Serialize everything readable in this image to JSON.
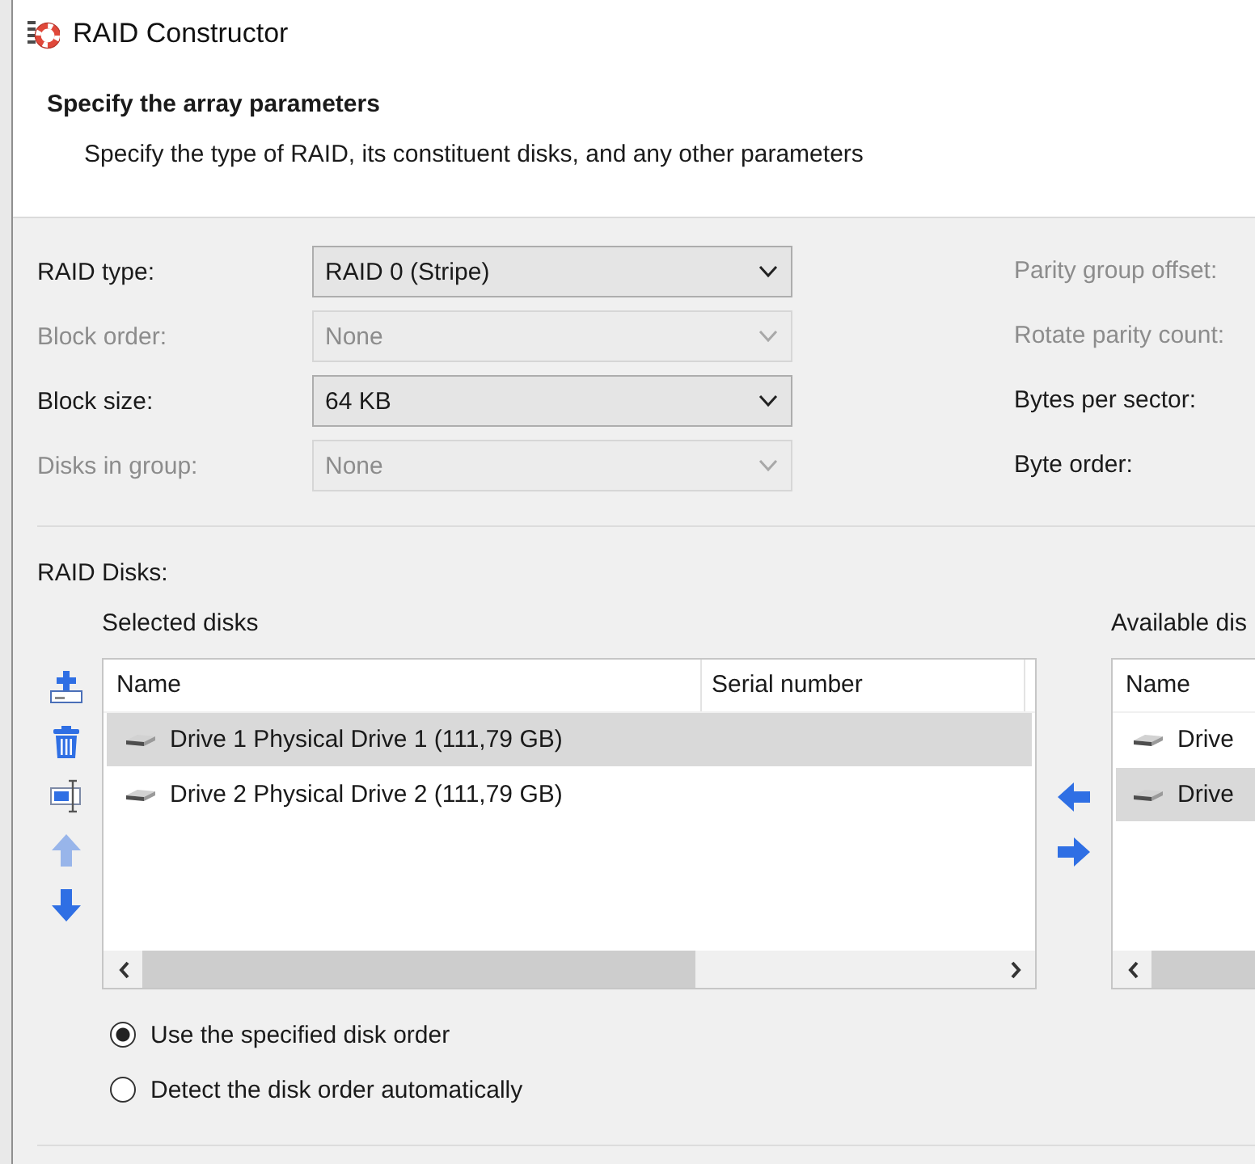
{
  "window": {
    "title": "RAID Constructor"
  },
  "header": {
    "title": "Specify the array parameters",
    "subtitle": "Specify the type of RAID, its constituent disks, and any other parameters"
  },
  "parameters": [
    {
      "label": "RAID type:",
      "value": "RAID 0 (Stripe)",
      "disabled": false
    },
    {
      "label": "Block order:",
      "value": "None",
      "disabled": true
    },
    {
      "label": "Block size:",
      "value": "64 KB",
      "disabled": false
    },
    {
      "label": "Disks in group:",
      "value": "None",
      "disabled": true
    }
  ],
  "side_parameters": [
    {
      "label": "Parity group offset:",
      "disabled": true
    },
    {
      "label": "Rotate parity count:",
      "disabled": true
    },
    {
      "label": "Bytes per sector:",
      "disabled": false
    },
    {
      "label": "Byte order:",
      "disabled": false
    }
  ],
  "disks": {
    "label": "RAID Disks:",
    "toolbar": [
      {
        "kind": "add",
        "disabled": false
      },
      {
        "kind": "delete",
        "disabled": false
      },
      {
        "kind": "resize",
        "disabled": false
      },
      {
        "kind": "up",
        "disabled": true
      },
      {
        "kind": "down",
        "disabled": false
      }
    ],
    "selected_list": {
      "label": "Selected disks",
      "columns": [
        "Name",
        "Serial number"
      ],
      "rows": [
        {
          "name": "Drive 1 Physical Drive 1 (111,79 GB)",
          "selected": true
        },
        {
          "name": "Drive 2 Physical Drive 2 (111,79 GB)",
          "selected": false
        }
      ]
    },
    "available_list": {
      "label": "Available dis",
      "columns": [
        "Name"
      ],
      "rows": [
        {
          "name": "Drive",
          "selected": false
        },
        {
          "name": "Drive",
          "selected": true
        }
      ]
    }
  },
  "disk_order": [
    {
      "label": "Use the specified disk order",
      "selected": true
    },
    {
      "label": "Detect the disk order automatically",
      "selected": false
    }
  ]
}
